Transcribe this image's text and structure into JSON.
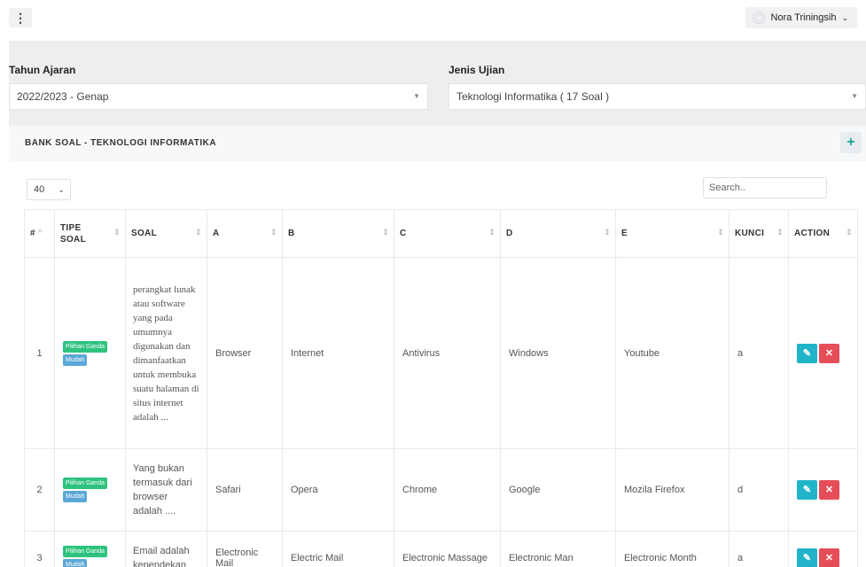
{
  "topbar": {
    "menu_icon": "⋮",
    "user_name": "Nora Triningsih",
    "chevron": "⌄"
  },
  "filters": {
    "tahun_label": "Tahun Ajaran",
    "tahun_value": "2022/2023 - Genap",
    "jenis_label": "Jenis Ujian",
    "jenis_value": "Teknologi Informatika ( 17 Soal )"
  },
  "card": {
    "title": "BANK SOAL - TEKNOLOGI INFORMATIKA",
    "add_icon": "+"
  },
  "table_controls": {
    "per_page": "40",
    "search_placeholder": "Search.."
  },
  "table": {
    "headers": {
      "num": "#",
      "tipe_soal": "TIPE SOAL",
      "soal": "SOAL",
      "a": "A",
      "b": "B",
      "c": "C",
      "d": "D",
      "e": "E",
      "kunci": "KUNCI",
      "action": "ACTION"
    },
    "rows": [
      {
        "num": "1",
        "tipe": "Pilihan Ganda",
        "level": "Mudah",
        "soal": "perangkat lunak atau software yang pada umumnya digunakan dan dimanfaatkan untuk membuka suatu halaman di situs internet adalah ...",
        "a": "Browser",
        "b": "Internet",
        "c": "Antivirus",
        "d": "Windows",
        "e": "Youtube",
        "kunci": "a"
      },
      {
        "num": "2",
        "tipe": "Pilihan Ganda",
        "level": "Mudah",
        "soal": "Yang bukan termasuk dari browser adalah ....",
        "a": "Safari",
        "b": "Opera",
        "c": "Chrome",
        "d": "Google",
        "e": "Mozila Firefox",
        "kunci": "d"
      },
      {
        "num": "3",
        "tipe": "Pilihan Ganda",
        "level": "Mudah",
        "soal": "Email adalah kependekan",
        "a": "Electronic Mail",
        "b": "Electric Mail",
        "c": "Electronic Massage",
        "d": "Electronic Man",
        "e": "Electronic Month",
        "kunci": "a"
      }
    ]
  }
}
